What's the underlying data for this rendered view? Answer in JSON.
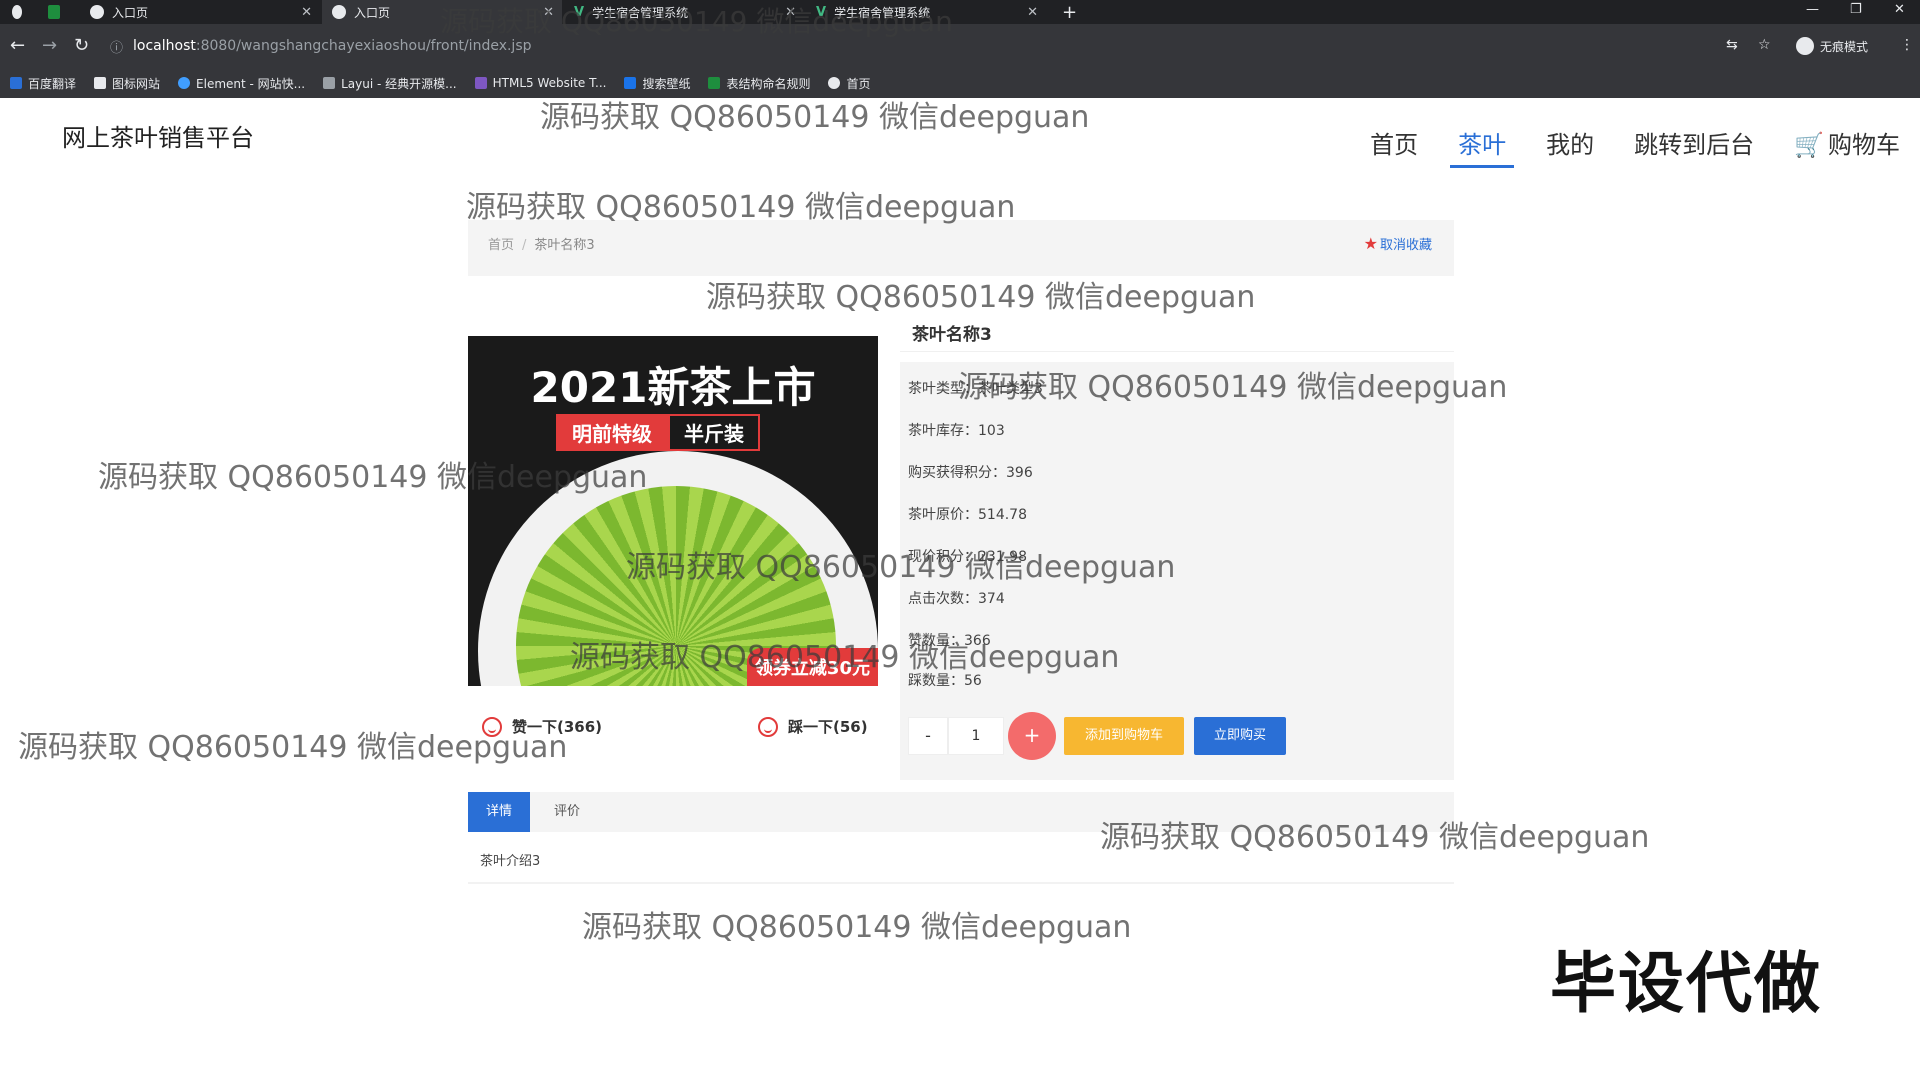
{
  "browser": {
    "tabs": [
      {
        "label": "入口页",
        "active": false
      },
      {
        "label": "入口页",
        "active": true
      },
      {
        "label": "学生宿舍管理系统",
        "active": false
      },
      {
        "label": "学生宿舍管理系统",
        "active": false
      }
    ],
    "url_host": "localhost",
    "url_path": ":8080/wangshangchayexiaoshou/front/index.jsp",
    "incognito_label": "无痕模式",
    "bookmarks": [
      "百度翻译",
      "图标网站",
      "Element - 网站快...",
      "Layui - 经典开源模...",
      "HTML5 Website T...",
      "搜索壁纸",
      "表结构命名规则",
      "首页"
    ]
  },
  "site": {
    "title": "网上茶叶销售平台",
    "nav": [
      "首页",
      "茶叶",
      "我的",
      "跳转到后台",
      "购物车"
    ],
    "active_nav_index": 1
  },
  "breadcrumb": {
    "home": "首页",
    "separator": "/",
    "current": "茶叶名称3"
  },
  "favorite_label": "取消收藏",
  "product": {
    "name": "茶叶名称3",
    "image": {
      "headline": "2021新茶上市",
      "tag1": "明前特级",
      "tag2": "半斤装",
      "coupon": "领券立减30元"
    },
    "votes": {
      "like": "赞一下(366)",
      "dislike": "踩一下(56)"
    },
    "fields": [
      "茶叶类型：茶叶类型3",
      "茶叶库存：103",
      "购买获得积分：396",
      "茶叶原价：514.78",
      "现价积分：231.98",
      "点击次数：374",
      "赞数量：366",
      "踩数量：56"
    ],
    "quantity": "1",
    "minus": "-",
    "plus": "+",
    "add_to_cart": "添加到购物车",
    "buy_now": "立即购买"
  },
  "tabs": {
    "detail": "详情",
    "review": "评价"
  },
  "detail_text": "茶叶介绍3",
  "overlay_text": "毕设代做",
  "watermark": "源码获取 QQ86050149 微信deepguan",
  "colors": {
    "accent": "#2a6fd6",
    "danger": "#e23b3b",
    "warning": "#f7b731"
  }
}
